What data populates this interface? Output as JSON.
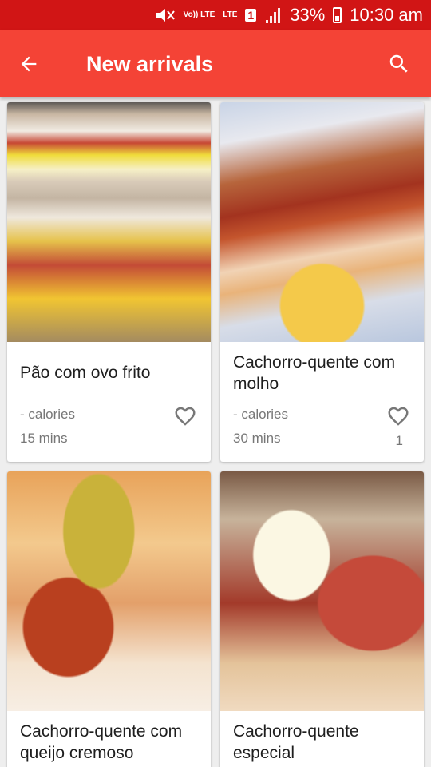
{
  "status_bar": {
    "volte": "Vo)) LTE",
    "lte": "LTE",
    "sim": "1",
    "battery_percent": "33%",
    "time": "10:30 am"
  },
  "app_bar": {
    "title": "New arrivals",
    "back_icon": "arrow-back-icon",
    "search_icon": "search-icon",
    "color": "#f44336",
    "status_color": "#d11515"
  },
  "recipes": [
    {
      "name": "Pão com ovo frito",
      "calories": "- calories",
      "time": "15 mins",
      "favorites": ""
    },
    {
      "name": "Cachorro-quente com molho",
      "calories": "- calories",
      "time": "30 mins",
      "favorites": "1"
    },
    {
      "name": "Cachorro-quente com queijo cremoso",
      "calories": "",
      "time": "",
      "favorites": ""
    },
    {
      "name": "Cachorro-quente especial",
      "calories": "",
      "time": "",
      "favorites": ""
    }
  ]
}
